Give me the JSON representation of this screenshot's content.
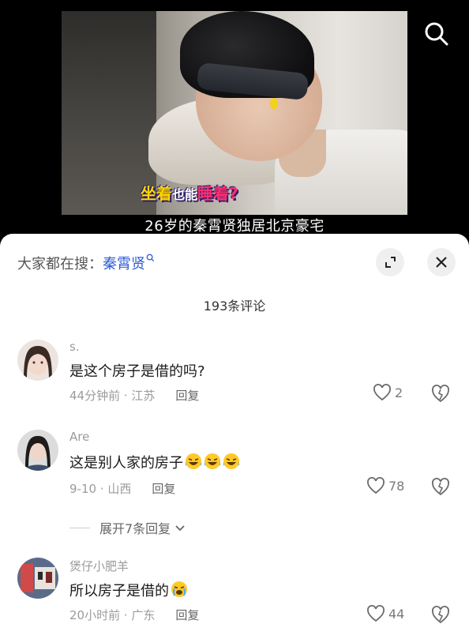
{
  "video": {
    "overlay_text": {
      "part1": "坐着",
      "part2": "也能",
      "part3": "睡着?"
    },
    "title": "26岁的秦霄贤独居北京豪宅"
  },
  "panel": {
    "hot_search_label": "大家都在搜：",
    "hot_search_keyword": "秦霄贤",
    "comment_count": "193条评论",
    "expand_replies": "展开7条回复"
  },
  "comments": [
    {
      "user": "s.",
      "text": "是这个房子是借的吗?",
      "time_loc": "44分钟前 · 江苏",
      "reply": "回复",
      "likes": "2"
    },
    {
      "user": "Are",
      "text": "这是别人家的房子",
      "time_loc": "9-10 · 山西",
      "reply": "回复",
      "likes": "78"
    },
    {
      "user": "煲仔小肥羊",
      "text": "所以房子是借的",
      "time_loc": "20小时前 · 广东",
      "reply": "回复",
      "likes": "44"
    }
  ]
}
